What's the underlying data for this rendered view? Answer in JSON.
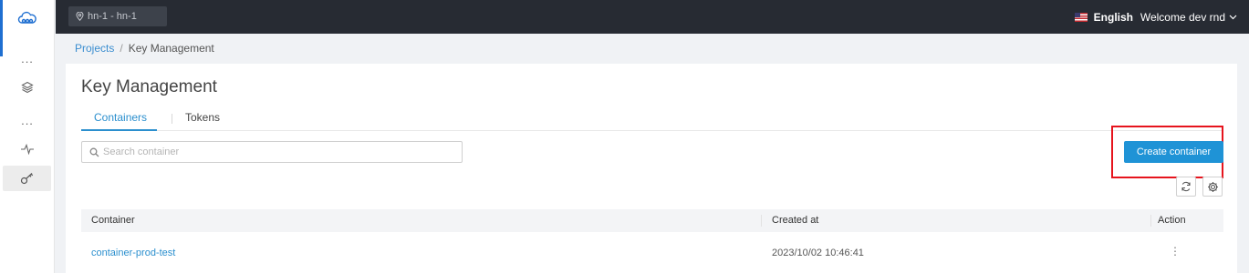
{
  "header": {
    "region": "hn-1 - hn-1",
    "language": "English",
    "welcome": "Welcome dev rnd"
  },
  "sidebar": {
    "items": [
      {
        "icon": "cloud-logo-icon"
      },
      {
        "icon": "more-icon",
        "label": "..."
      },
      {
        "icon": "layers-icon"
      },
      {
        "icon": "more-icon",
        "label": "..."
      },
      {
        "icon": "activity-icon"
      },
      {
        "icon": "key-icon",
        "selected": true
      }
    ]
  },
  "breadcrumb": {
    "items": [
      "Projects",
      "Key Management"
    ],
    "separator": "/"
  },
  "page": {
    "title": "Key Management",
    "tabs": [
      "Containers",
      "Tokens"
    ],
    "active_tab": 0
  },
  "search": {
    "placeholder": "Search container",
    "value": ""
  },
  "actions": {
    "create_label": "Create container"
  },
  "table": {
    "columns": [
      "Container",
      "Created at",
      "Action"
    ],
    "rows": [
      {
        "name": "container-prod-test",
        "created_at": "2023/10/02 10:46:41",
        "action": "⋮"
      }
    ]
  },
  "colors": {
    "accent": "#1f93d6",
    "header_bg": "#272b33",
    "highlight": "#e6141d"
  }
}
